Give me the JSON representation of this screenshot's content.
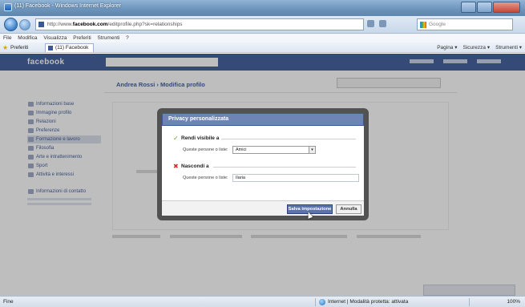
{
  "window": {
    "title": "(11) Facebook - Windows Internet Explorer"
  },
  "address": {
    "url_prefix": "http://www.",
    "url_domain": "facebook.com",
    "url_suffix": "/editprofile.php?sk=relationships",
    "search_placeholder": "Google"
  },
  "menu": {
    "items": [
      "File",
      "Modifica",
      "Visualizza",
      "Preferiti",
      "Strumenti",
      "?"
    ]
  },
  "favorites": {
    "label": "Preferiti",
    "tab_label": "(11) Facebook",
    "commands": [
      "Pagina ▾",
      "Sicurezza ▾",
      "Strumenti ▾"
    ]
  },
  "facebook": {
    "logo": "facebook",
    "breadcrumb": "Andrea Rossi › Modifica profilo",
    "sidebar": [
      "Informazioni base",
      "Immagine profilo",
      "Relazioni",
      "Preferenze",
      "Formazione e lavoro",
      "Filosofia",
      "Arte e intrattenimento",
      "Sport",
      "Attività e interessi",
      "Informazioni di contatto"
    ],
    "sidebar_active_index": 4
  },
  "dialog": {
    "title": "Privacy personalizzata",
    "visible_section": {
      "heading": "Rendi visibile a",
      "field_label": "Queste persone o liste:",
      "selected_option": "Amici"
    },
    "hide_section": {
      "heading": "Nascondi a",
      "field_label": "Queste persone o liste:",
      "value": "Ilaria"
    },
    "save_button": "Salva impostazione",
    "cancel_button": "Annulla"
  },
  "status": {
    "left": "Fine",
    "zone": "Internet | Modalità protetta: attivata",
    "zoom": "100%"
  },
  "colors": {
    "facebook_blue": "#3b5998",
    "dialog_header": "#6d84b4",
    "check_green": "#5fa52e",
    "cross_red": "#d12f2f"
  }
}
